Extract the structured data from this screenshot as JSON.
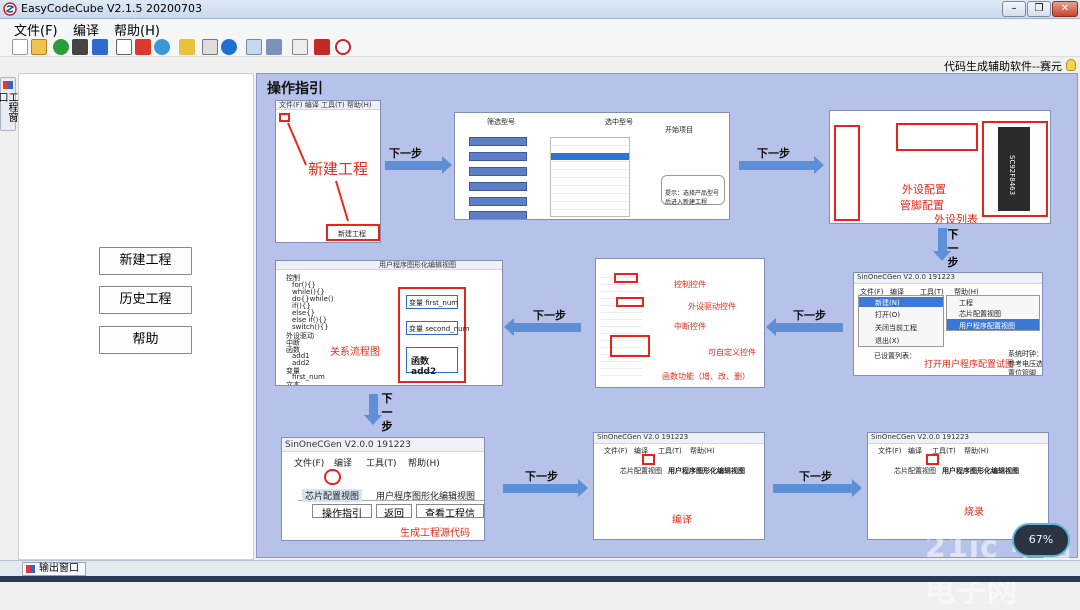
{
  "window": {
    "title": "EasyCodeCube V2.1.5 20200703"
  },
  "menubar": {
    "items": [
      "文件(F)",
      "编译",
      "帮助(H)"
    ]
  },
  "statusline": {
    "text": "代码生成辅助软件--赛元"
  },
  "sidebar": {
    "tab_label": "工程窗口"
  },
  "leftpane": {
    "buttons": [
      "新建工程",
      "历史工程",
      "帮助"
    ]
  },
  "guide": {
    "title": "操作指引",
    "step_label": "下一步",
    "shot1": {
      "menu": "文件(F)  编译  工具(T)  帮助(H)",
      "annotation": "新建工程",
      "button": "新建工程"
    },
    "shot2": {
      "labels": [
        "筛选型号",
        "选中型号",
        "开始项目"
      ],
      "tip": "提示：选择产品型号后进入新建工程"
    },
    "shot3": {
      "annotations": [
        "外设配置",
        "管脚配置",
        "外设列表"
      ],
      "chip": "SC92F8463"
    },
    "shot4": {
      "title": "SinOneCGen V2.0.0 191223",
      "menu": [
        "文件(F)",
        "编译",
        "工具(T)",
        "帮助(H)"
      ],
      "menu_items": [
        "新建(N)",
        "打开(O)",
        "关闭当前工程",
        "退出(X)"
      ],
      "submenu": [
        "工程",
        "芯片配置视图",
        "用户程序配置视图"
      ],
      "annotation": "打开用户程序配置试图",
      "extra": [
        "已设置列表：",
        "系统时钟：",
        "参考电压选",
        "置位管脚"
      ]
    },
    "shot5": {
      "annotations": [
        "控制控件",
        "外设驱动控件",
        "中断控件",
        "可自定义控件",
        "函数功能（增、改、删）"
      ]
    },
    "shot6": {
      "tab": "用户程序图形化编辑视图",
      "tree": [
        "控制",
        "for(){}",
        "while(){}",
        "do{}while()",
        "if(){}",
        "else{}",
        "else if(){}",
        "switch(){}",
        "外设驱动",
        "中断",
        "函数",
        "add1",
        "add2",
        "变量",
        "first_num",
        "文本"
      ],
      "annotation": "关系流程图",
      "boxes": [
        "变量 first_num",
        "变量 second_num",
        "函数 add2"
      ]
    },
    "shot7": {
      "title": "SinOneCGen V2.0.0 191223",
      "menu": [
        "文件(F)",
        "编译",
        "工具(T)",
        "帮助(H)"
      ],
      "tabs": [
        "芯片配置视图",
        "用户程序图形化编辑视图"
      ],
      "buttons": [
        "操作指引",
        "返回",
        "查看工程信"
      ],
      "annotation": "生成工程源代码"
    },
    "shot8": {
      "title": "SinOneCGen V2.0 191223",
      "menu": [
        "文件(F)",
        "编译",
        "工具(T)",
        "帮助(H)"
      ],
      "tabs": [
        "芯片配置视图",
        "用户程序图形化编辑视图"
      ],
      "annotation": "编译"
    },
    "shot9": {
      "title": "SinOneCGen V2.0.0 191223",
      "menu": [
        "文件(F)",
        "编译",
        "工具(T)",
        "帮助(H)"
      ],
      "tabs": [
        "芯片配置视图",
        "用户程序图形化编辑视图"
      ],
      "annotation": "烧录"
    }
  },
  "output": {
    "tab_label": "输出窗口"
  },
  "overlay": {
    "watermark": "21ic 中国电子网",
    "gauge": "67%"
  },
  "colors": {
    "guide_bg": "#b7c2ea",
    "arrow": "#5d8fd6",
    "annotation": "#e42a18"
  }
}
